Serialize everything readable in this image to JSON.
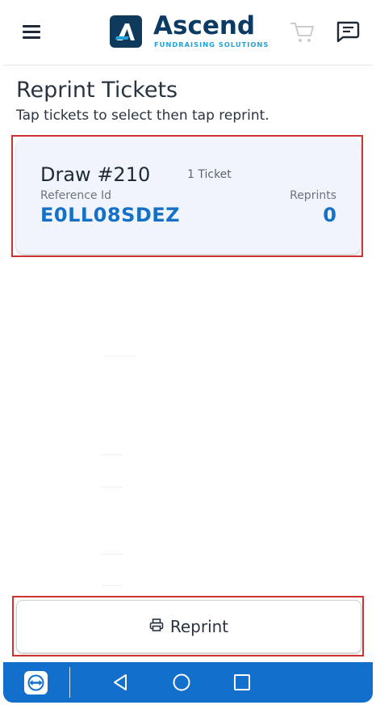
{
  "header": {
    "logo_text": "Ascend",
    "logo_subtitle": "FUNDRAISING SOLUTIONS"
  },
  "page": {
    "title": "Reprint Tickets",
    "subtitle": "Tap tickets to select then tap reprint."
  },
  "ticket": {
    "draw": "Draw #210",
    "count": "1 Ticket",
    "reference_label": "Reference Id",
    "reference_value": "E0LL08SDEZ",
    "reprints_label": "Reprints",
    "reprints_value": "0"
  },
  "actions": {
    "reprint_label": "Reprint"
  },
  "colors": {
    "accent": "#1570c8",
    "navbar": "#1270cc",
    "selection_outline": "#cc3333",
    "logo_dark": "#0b3a63",
    "logo_light": "#21a1d8"
  },
  "icons": {
    "menu": "hamburger-icon",
    "cart": "cart-icon",
    "messages": "chat-icon",
    "reprint": "printer-icon",
    "remote": "teamviewer-icon",
    "back": "back-triangle-icon",
    "home": "home-circle-icon",
    "recents": "recents-square-icon"
  }
}
